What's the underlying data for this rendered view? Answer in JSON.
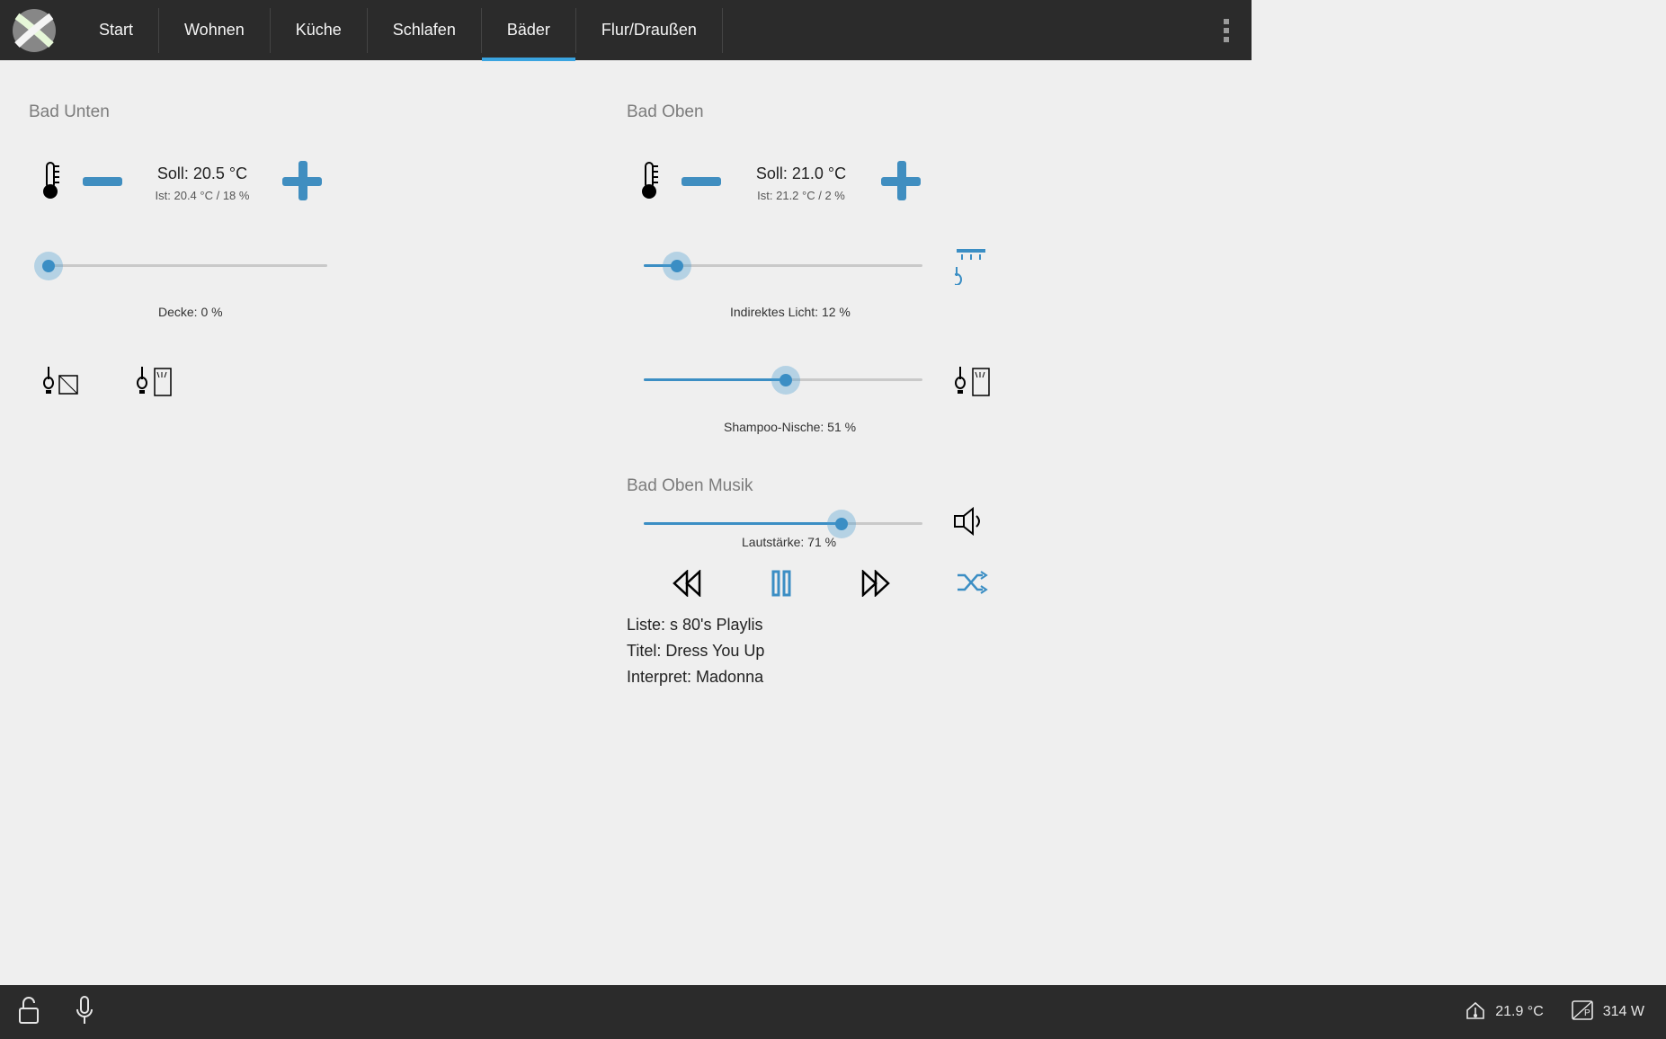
{
  "nav": {
    "items": [
      {
        "label": "Start"
      },
      {
        "label": "Wohnen"
      },
      {
        "label": "Küche"
      },
      {
        "label": "Schlafen"
      },
      {
        "label": "Bäder",
        "active": true
      },
      {
        "label": "Flur/Draußen"
      }
    ]
  },
  "colors": {
    "accent": "#3aa4e0",
    "slider": "#3b8ec4"
  },
  "rooms": {
    "bad_unten": {
      "title": "Bad Unten",
      "therm": {
        "soll": "Soll: 20.5 °C",
        "ist": "Ist: 20.4 °C / 18 %"
      },
      "slider_decke": {
        "label": "Decke:  0 %",
        "percent": 0
      }
    },
    "bad_oben": {
      "title": "Bad Oben",
      "therm": {
        "soll": "Soll: 21.0 °C",
        "ist": "Ist: 21.2 °C / 2 %"
      },
      "slider_indirekt": {
        "label": "Indirektes Licht:  12 %",
        "percent": 12
      },
      "slider_shampoo": {
        "label": "Shampoo-Nische:  51 %",
        "percent": 51
      },
      "music_title": "Bad Oben Musik",
      "slider_volume": {
        "label": "Lautstärke:  71 %",
        "percent": 71
      },
      "music": {
        "liste": "Liste: s 80's Playlis",
        "titel": "Titel: Dress You Up",
        "interpret": "Interpret:  Madonna"
      }
    }
  },
  "bottombar": {
    "temp": "21.9 °C",
    "power": "314 W"
  }
}
